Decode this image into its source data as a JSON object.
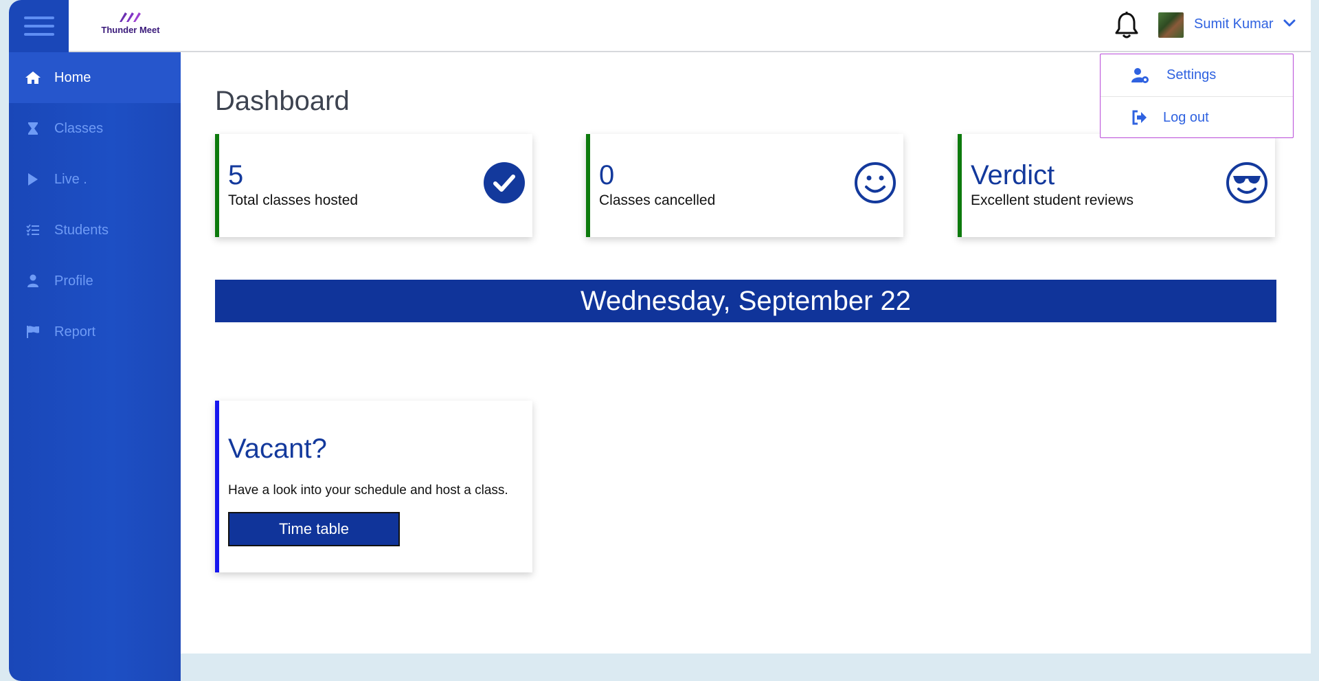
{
  "header": {
    "logo_text": "Thunder Meet",
    "user_name": "Sumit Kumar"
  },
  "sidebar": {
    "items": [
      {
        "label": "Home",
        "icon": "home-icon",
        "active": true
      },
      {
        "label": "Classes",
        "icon": "hourglass-icon",
        "active": false
      },
      {
        "label": "Live .",
        "icon": "play-icon",
        "active": false
      },
      {
        "label": "Students",
        "icon": "list-check-icon",
        "active": false
      },
      {
        "label": "Profile",
        "icon": "user-icon",
        "active": false
      },
      {
        "label": "Report",
        "icon": "flag-icon",
        "active": false
      }
    ]
  },
  "main": {
    "title": "Dashboard",
    "cards": [
      {
        "value": "5",
        "label": "Total classes hosted",
        "icon": "check-circle-icon"
      },
      {
        "value": "0",
        "label": "Classes cancelled",
        "icon": "smile-icon"
      },
      {
        "value": "Verdict",
        "label": "Excellent student reviews",
        "icon": "smile-sunglasses-icon"
      }
    ],
    "date": "Wednesday, September 22",
    "vacant": {
      "title": "Vacant?",
      "text": "Have a look into your schedule and host a class.",
      "button": "Time table"
    }
  },
  "dropdown": {
    "items": [
      {
        "label": "Settings",
        "icon": "user-gear-icon"
      },
      {
        "label": "Log out",
        "icon": "logout-icon"
      }
    ]
  },
  "colors": {
    "sidebar": "#1a47b8",
    "accent": "#10349a",
    "link": "#2f62e0",
    "card_border": "#0d7a0d",
    "vacant_border": "#1616ee",
    "dropdown_border": "#b84ad8"
  }
}
